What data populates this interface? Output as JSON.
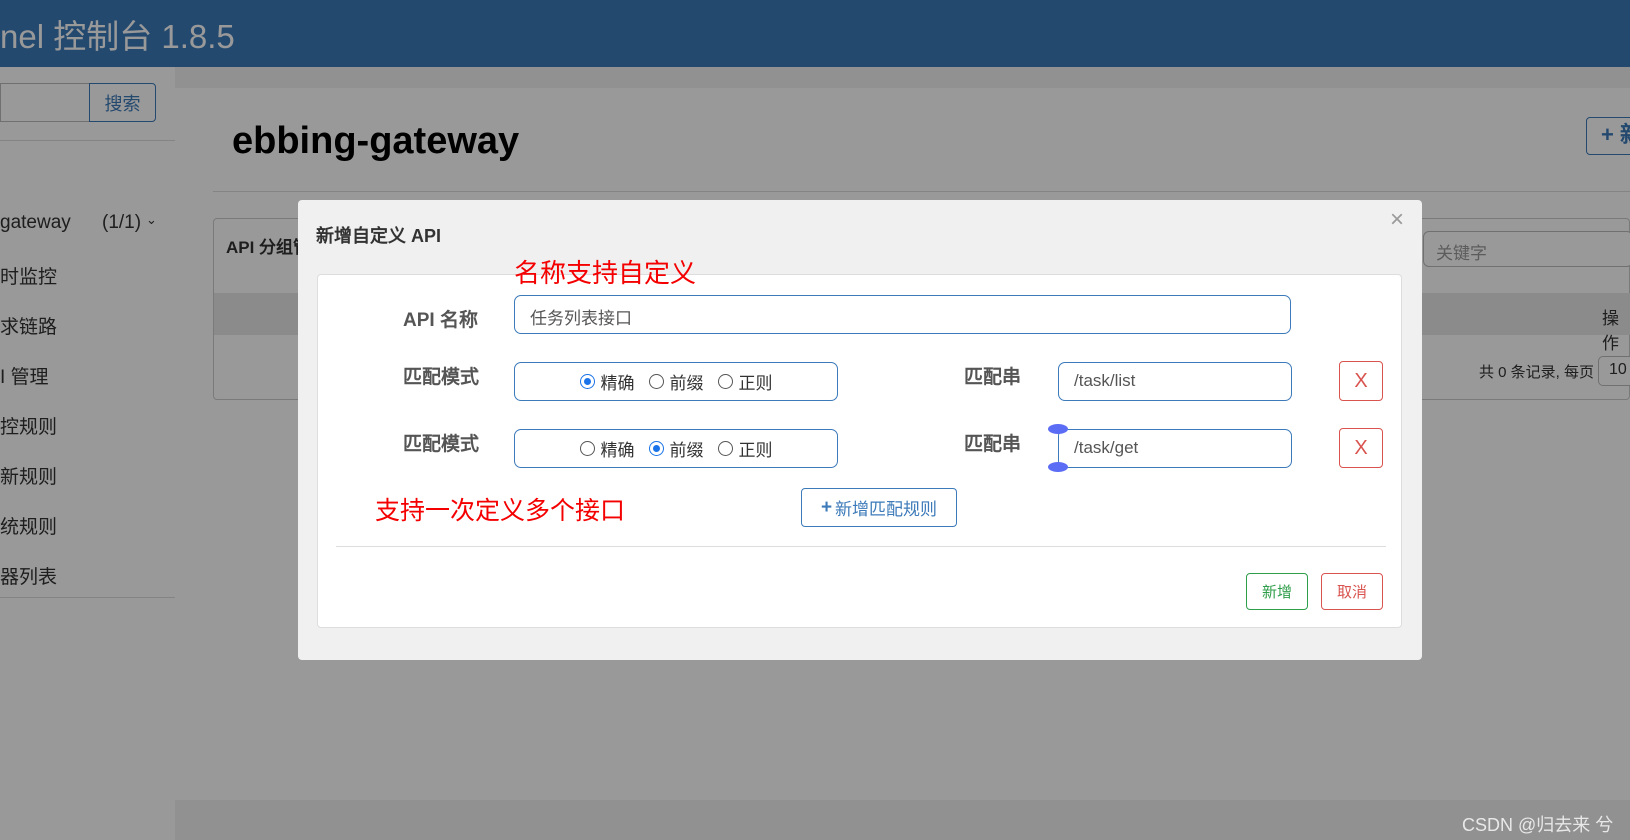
{
  "header": {
    "title": "nel 控制台 1.8.5"
  },
  "sidebar": {
    "search_button": "搜索",
    "app": {
      "name": "gateway",
      "count": "(1/1)"
    },
    "items": [
      {
        "label": "时监控"
      },
      {
        "label": "求链路"
      },
      {
        "label": "I 管理"
      },
      {
        "label": "控规则"
      },
      {
        "label": "新规则"
      },
      {
        "label": "统规则"
      },
      {
        "label": "器列表"
      }
    ]
  },
  "main": {
    "title": "ebbing-gateway",
    "add_button": "+ 新",
    "panel_title": "API 分组管",
    "keyword_placeholder": "关键字",
    "table_header_op": "操作",
    "pager_text": "共 0 条记录, 每页",
    "pager_size": "10"
  },
  "modal": {
    "title": "新增自定义 API",
    "close": "×",
    "api_name_label": "API 名称",
    "api_name_value": "任务列表接口",
    "rules": [
      {
        "mode_label": "匹配模式",
        "selected": "精确",
        "pattern_label": "匹配串",
        "pattern": "/task/list",
        "delete": "X"
      },
      {
        "mode_label": "匹配模式",
        "selected": "前缀",
        "pattern_label": "匹配串",
        "pattern": "/task/get",
        "delete": "X"
      }
    ],
    "mode_options": [
      "精确",
      "前缀",
      "正则"
    ],
    "add_rule_button": "新增匹配规则",
    "submit_button": "新增",
    "cancel_button": "取消"
  },
  "annotations": {
    "name_note": "名称支持自定义",
    "multi_note": "支持一次定义多个接口"
  },
  "watermark": "CSDN @归去来 兮",
  "colors": {
    "header": "#3c7ab9",
    "annotation": "#f40000",
    "success": "#2f9e4a",
    "danger": "#d9534f"
  }
}
